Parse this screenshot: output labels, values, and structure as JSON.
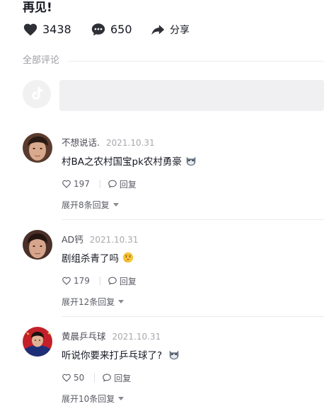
{
  "video": {
    "title": "再见!",
    "likes": "3438",
    "comments": "650",
    "share_label": "分享"
  },
  "comments_section": {
    "label": "全部评论",
    "input_placeholder": ""
  },
  "comments": [
    {
      "name": "不想说话.",
      "date": "2021.10.31",
      "text": "村BA之农村国宝pk农村勇豪",
      "emoji": "cat-face-emoji",
      "likes": "197",
      "reply_label": "回复",
      "expand_label": "展开8条回复"
    },
    {
      "name": "AD钙",
      "date": "2021.10.31",
      "text": "剧组杀青了吗",
      "emoji": "thinking-face-emoji",
      "likes": "179",
      "reply_label": "回复",
      "expand_label": "展开12条回复"
    },
    {
      "name": "黄晨乒乓球",
      "date": "2021.10.31",
      "text": "听说你要来打乒乓球了?",
      "emoji": "cat-face-emoji",
      "likes": "50",
      "reply_label": "回复",
      "expand_label": "展开10条回复"
    }
  ]
}
